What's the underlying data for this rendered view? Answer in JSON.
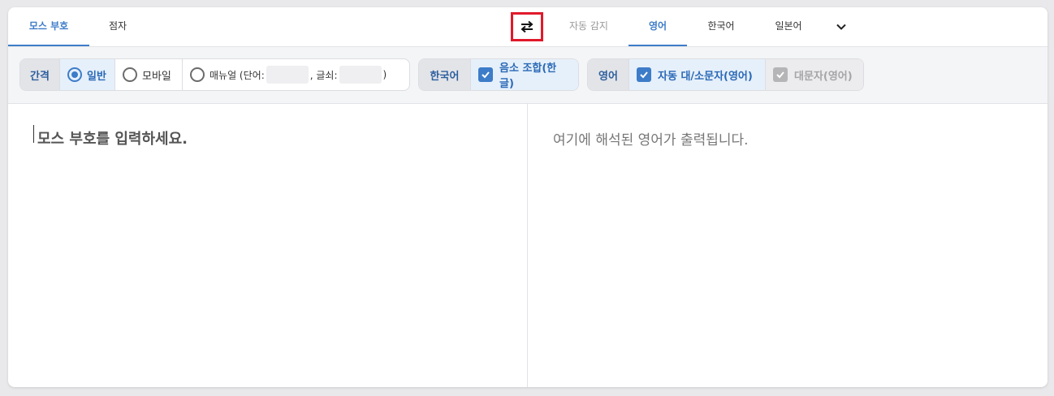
{
  "source_tabs": [
    {
      "label": "모스 부호",
      "active": true
    },
    {
      "label": "점자",
      "active": false
    }
  ],
  "swap_icon": "swap-horizontal-arrows",
  "target_tabs": [
    {
      "label": "자동 감지",
      "active": false
    },
    {
      "label": "영어",
      "active": true
    },
    {
      "label": "한국어",
      "active": false
    },
    {
      "label": "일본어",
      "active": false
    }
  ],
  "more_icon": "chevron-down",
  "options": {
    "spacing": {
      "label": "간격",
      "items": [
        "일반",
        "모바일",
        "매뉴얼 (단어:",
        ", 글쇠:",
        ")"
      ],
      "selected": "일반"
    },
    "korean": {
      "label": "한국어",
      "phoneme_combine": "음소 조합(한글)",
      "checked": true
    },
    "english": {
      "label": "영어",
      "auto_case": "자동 대/소문자(영어)",
      "auto_case_checked": true,
      "uppercase": "대문자(영어)",
      "uppercase_checked": true,
      "uppercase_disabled": true
    }
  },
  "input": {
    "placeholder": "모스 부호를 입력하세요."
  },
  "output": {
    "placeholder": "여기에 해석된 영어가 출력됩니다."
  },
  "colors": {
    "accent": "#3d7cc8",
    "highlight": "#e0192a"
  }
}
